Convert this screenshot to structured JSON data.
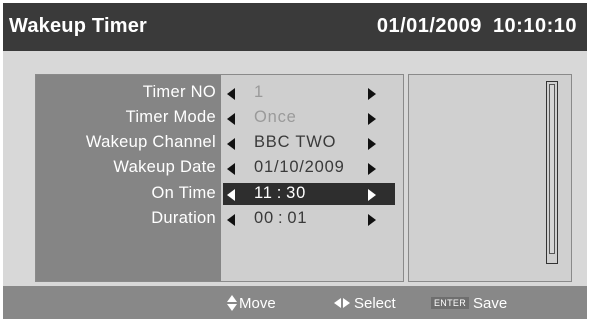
{
  "header": {
    "title": "Wakeup Timer",
    "date": "01/01/2009",
    "time": "10:10:10"
  },
  "colors": {
    "title_bar": "#3a3a3a",
    "label_column": "#858585",
    "value_column": "#cfcfcf",
    "selected_row": "#2e2e2e",
    "footer": "#888888"
  },
  "form": {
    "rows": [
      {
        "label": "Timer NO",
        "value": "1",
        "state": "disabled"
      },
      {
        "label": "Timer Mode",
        "value": "Once",
        "state": "disabled"
      },
      {
        "label": "Wakeup Channel",
        "value": "BBC TWO",
        "state": "normal"
      },
      {
        "label": "Wakeup Date",
        "value": "01/10/2009",
        "state": "normal"
      },
      {
        "label": "On Time",
        "value_hh": "11",
        "value_sep": ":",
        "value_mm": "30",
        "state": "selected"
      },
      {
        "label": "Duration",
        "value_hh": "00",
        "value_sep": ":",
        "value_mm": "01",
        "state": "normal"
      }
    ]
  },
  "footer": {
    "move_icon": "up-down-arrow-icon",
    "move_label": "Move",
    "select_icon": "left-right-arrow-icon",
    "select_label": "Select",
    "enter_key_label": "ENTER",
    "save_label": "Save"
  }
}
